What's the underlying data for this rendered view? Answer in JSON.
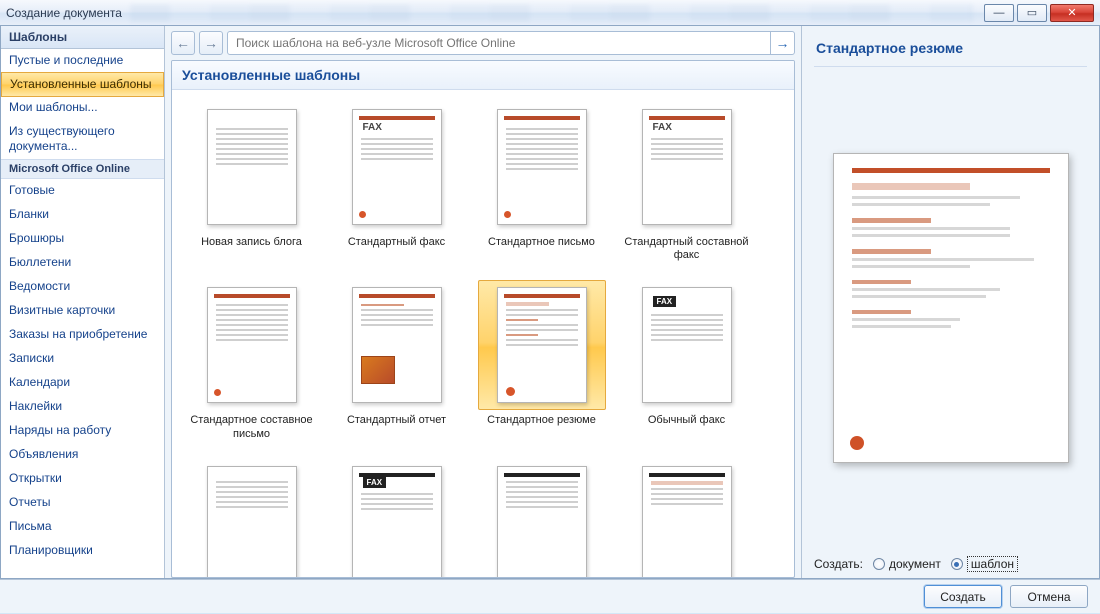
{
  "window": {
    "title": "Создание документа"
  },
  "sidebar": {
    "header": "Шаблоны",
    "items_top": [
      "Пустые и последние",
      "Установленные шаблоны",
      "Мои шаблоны...",
      "Из существующего документа..."
    ],
    "subheader": "Microsoft Office Online",
    "items_online": [
      "Готовые",
      "Бланки",
      "Брошюры",
      "Бюллетени",
      "Ведомости",
      "Визитные карточки",
      "Заказы на приобретение",
      "Записки",
      "Календари",
      "Наклейки",
      "Наряды на работу",
      "Объявления",
      "Открытки",
      "Отчеты",
      "Письма",
      "Планировщики"
    ],
    "selected_top_index": 1
  },
  "nav": {
    "search_placeholder": "Поиск шаблона на веб-узле Microsoft Office Online"
  },
  "gallery": {
    "title": "Установленные шаблоны",
    "selected_index": 5,
    "templates": [
      "Новая запись блога",
      "Стандартный факс",
      "Стандартное письмо",
      "Стандартный составной факс",
      "Стандартное составное письмо",
      "Стандартный отчет",
      "Стандартное резюме",
      "Обычный факс",
      "",
      "",
      "",
      ""
    ]
  },
  "preview": {
    "title": "Стандартное резюме"
  },
  "create": {
    "label": "Создать:",
    "option_document": "документ",
    "option_template": "шаблон",
    "selected": "template"
  },
  "buttons": {
    "create": "Создать",
    "cancel": "Отмена"
  }
}
